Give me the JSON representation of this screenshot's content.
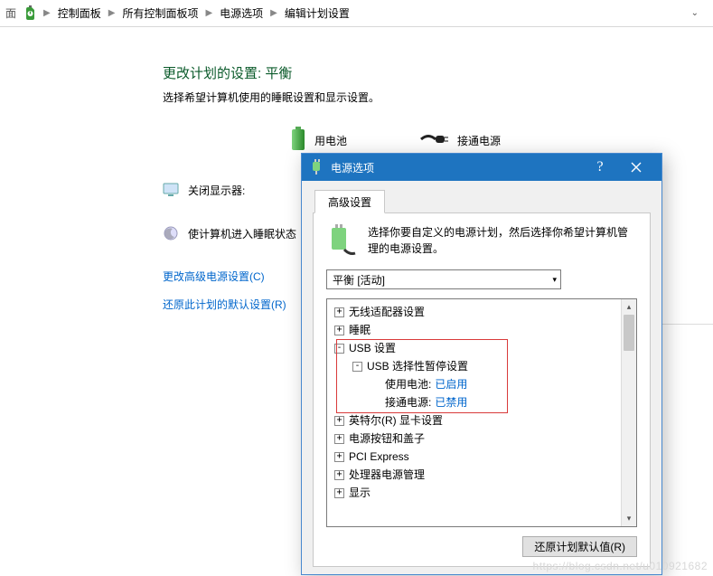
{
  "addrbar": {
    "back_label": "面",
    "crumbs": [
      "控制面板",
      "所有控制面板项",
      "电源选项",
      "编辑计划设置"
    ]
  },
  "page": {
    "title": "更改计划的设置: 平衡",
    "subtitle": "选择希望计算机使用的睡眠设置和显示设置。",
    "cols": {
      "battery": "用电池",
      "plugged": "接通电源"
    },
    "rows": {
      "display_off": "关闭显示器:",
      "sleep": "使计算机进入睡眠状态"
    },
    "links": {
      "advanced": "更改高级电源设置(C)",
      "restore": "还原此计划的默认设置(R)"
    }
  },
  "dialog": {
    "title": "电源选项",
    "tab_label": "高级设置",
    "description": "选择你要自定义的电源计划，然后选择你希望计算机管理的电源设置。",
    "plan_selected": "平衡 [活动]",
    "tree": [
      {
        "indent": 0,
        "exp": "+",
        "label": "无线适配器设置"
      },
      {
        "indent": 0,
        "exp": "+",
        "label": "睡眠"
      },
      {
        "indent": 0,
        "exp": "-",
        "label": "USB 设置"
      },
      {
        "indent": 1,
        "exp": "-",
        "label": "USB 选择性暂停设置"
      },
      {
        "indent": 2,
        "exp": "",
        "label": "使用电池:",
        "value": "已启用"
      },
      {
        "indent": 2,
        "exp": "",
        "label": "接通电源:",
        "value": "已禁用"
      },
      {
        "indent": 0,
        "exp": "+",
        "label": "英特尔(R) 显卡设置"
      },
      {
        "indent": 0,
        "exp": "+",
        "label": "电源按钮和盖子"
      },
      {
        "indent": 0,
        "exp": "+",
        "label": "PCI Express"
      },
      {
        "indent": 0,
        "exp": "+",
        "label": "处理器电源管理"
      },
      {
        "indent": 0,
        "exp": "+",
        "label": "显示"
      }
    ],
    "restore_defaults_btn": "还原计划默认值(R)"
  },
  "watermark": "https://blog.csdn.net/u010921682"
}
